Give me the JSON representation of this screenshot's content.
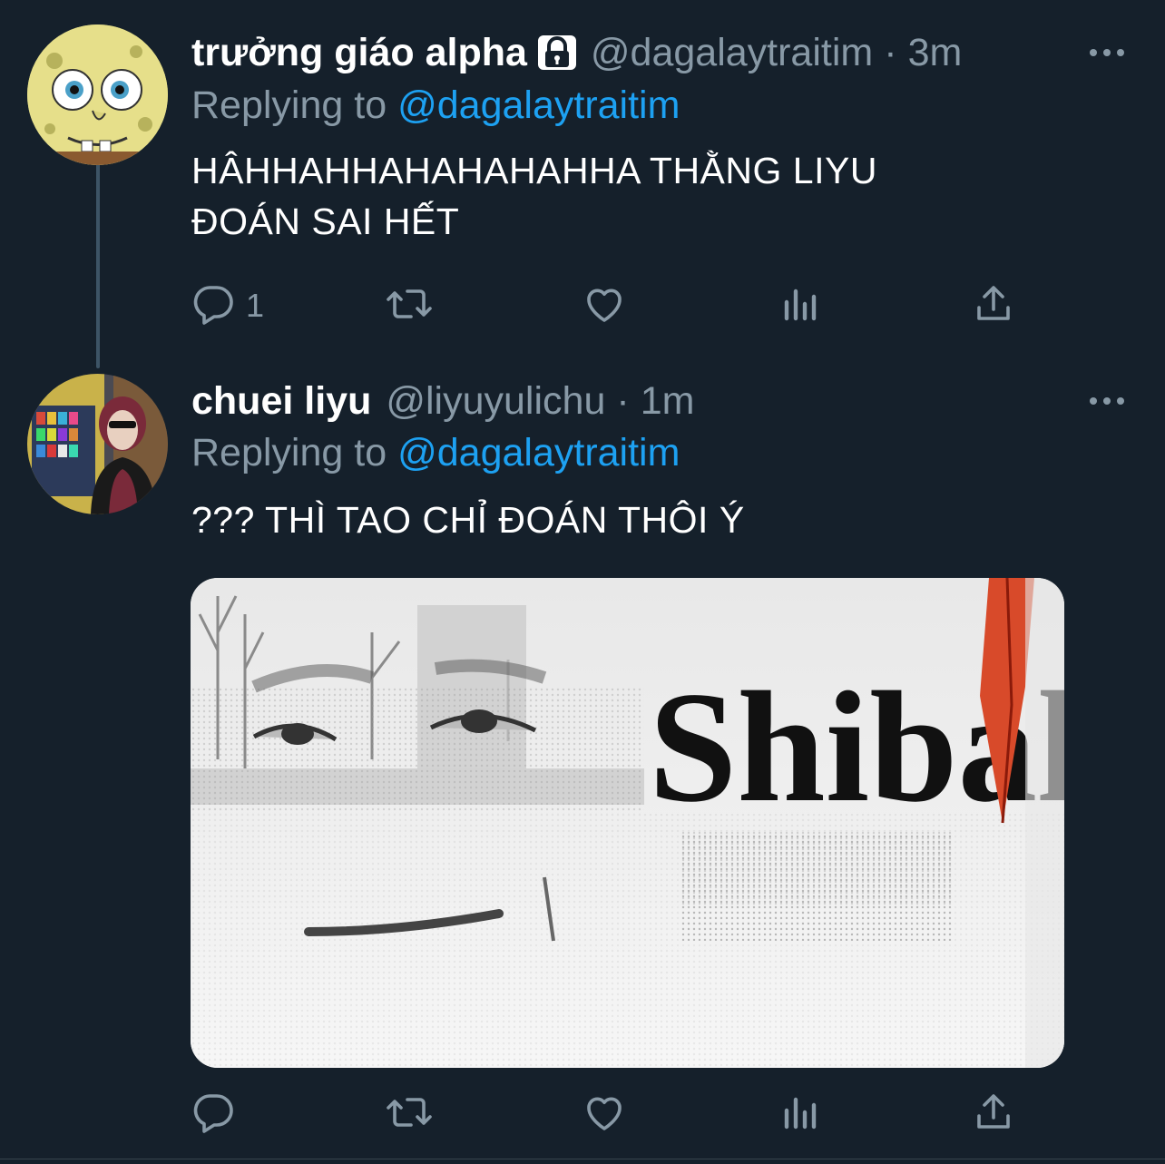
{
  "tweets": [
    {
      "name": "trưởng giáo alpha",
      "protected": true,
      "handle": "@dagalaytraitim",
      "separator": "·",
      "time": "3m",
      "replying_prefix": "Replying to",
      "replying_to": "@dagalaytraitim",
      "text_line1": "HÂHHAHHAHAHAHAHHA THẰNG LIYU",
      "text_line2": "ĐOÁN SAI HẾT",
      "reply_count": "1"
    },
    {
      "name": "chuei liyu",
      "handle": "@liyuyulichu",
      "separator": "·",
      "time": "1m",
      "replying_prefix": "Replying to",
      "replying_to": "@dagalaytraitim",
      "text_line1": "??? THÌ TAO CHỈ ĐOÁN THÔI Ý",
      "media": {
        "caption_text": "Shibal"
      }
    }
  ],
  "icons": {
    "reply": "reply-icon",
    "retweet": "retweet-icon",
    "like": "heart-icon",
    "analytics": "analytics-icon",
    "share": "share-icon",
    "more": "more-icon",
    "lock": "lock-icon"
  },
  "colors": {
    "background": "#15202b",
    "secondary_text": "#8899a6",
    "link": "#1da1f2",
    "icon": "#8899a6"
  }
}
